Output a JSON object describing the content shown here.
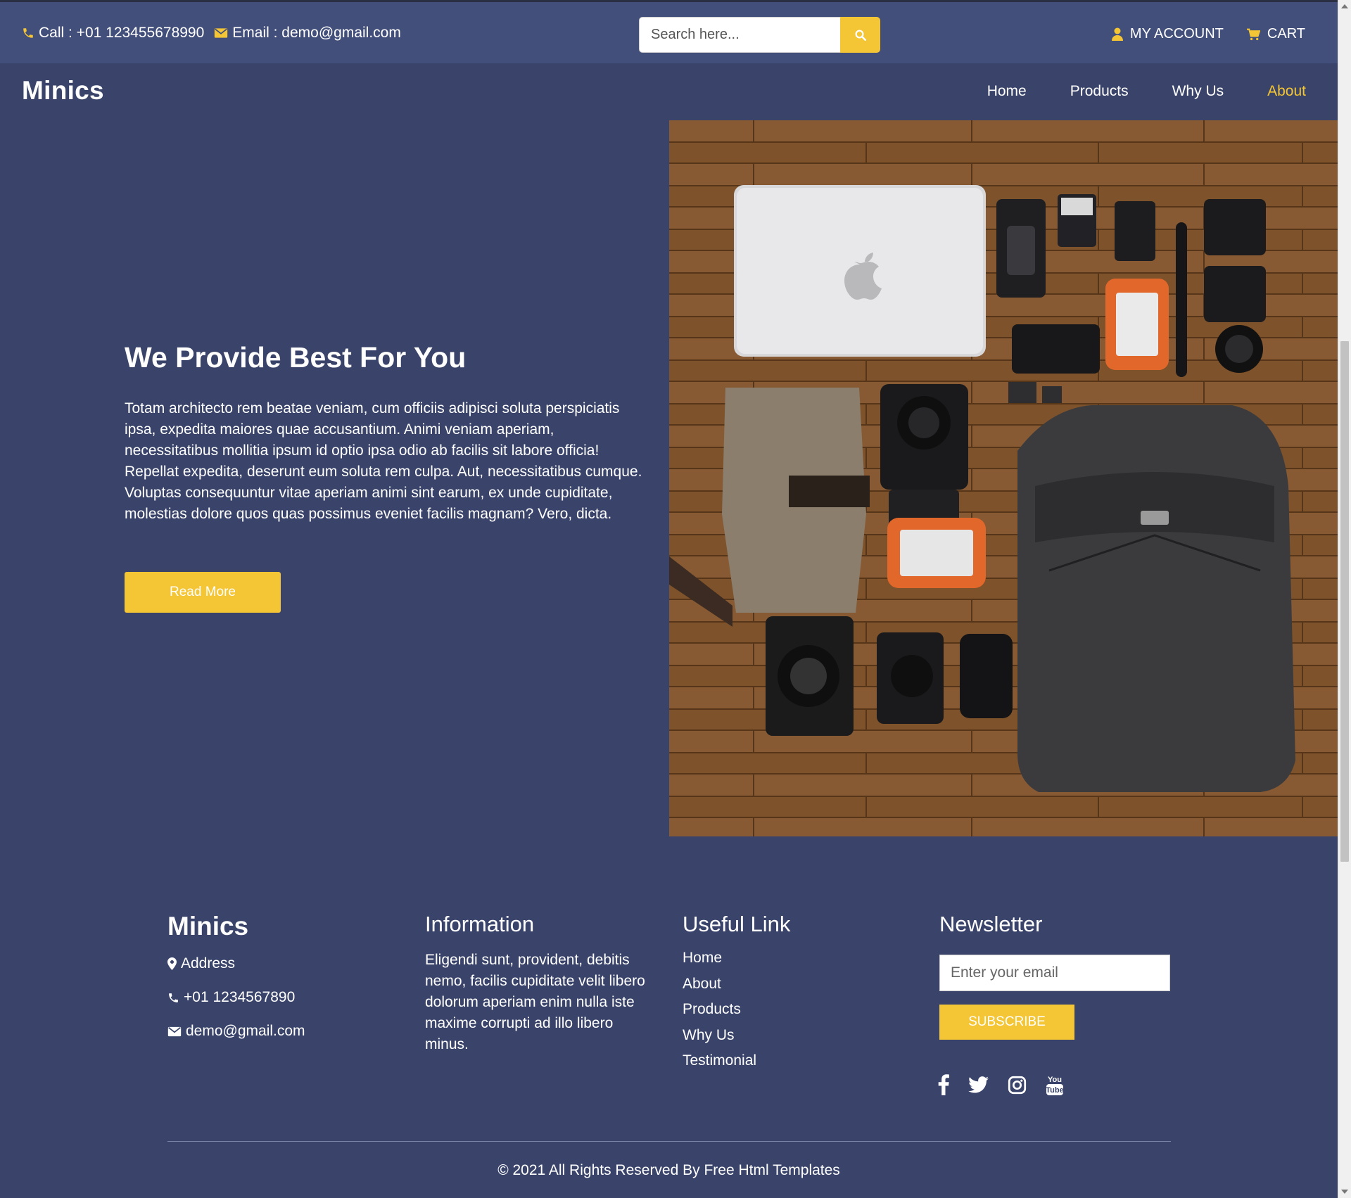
{
  "topbar": {
    "call_text": "Call : +01 123455678990",
    "email_text": "Email : demo@gmail.com",
    "search_placeholder": "Search here...",
    "my_account": "MY ACCOUNT",
    "cart": "CART"
  },
  "brand": {
    "name": "Minics"
  },
  "nav": {
    "items": [
      "Home",
      "Products",
      "Why Us",
      "About"
    ],
    "active": "About"
  },
  "hero": {
    "title": "We Provide Best For You",
    "body": "Totam architecto rem beatae veniam, cum officiis adipisci soluta perspiciatis ipsa, expedita maiores quae accusantium. Animi veniam aperiam, necessitatibus mollitia ipsum id optio ipsa odio ab facilis sit labore officia! Repellat expedita, deserunt eum soluta rem culpa. Aut, necessitatibus cumque. Voluptas consequuntur vitae aperiam animi sint earum, ex unde cupiditate, molestias dolore quos quas possimus eveniet facilis magnam? Vero, dicta.",
    "button": "Read More"
  },
  "footer": {
    "brand": "Minics",
    "address": "Address",
    "phone": "+01 1234567890",
    "email": "demo@gmail.com",
    "info_heading": "Information",
    "info_text": "Eligendi sunt, provident, debitis nemo, facilis cupiditate velit libero dolorum aperiam enim nulla iste maxime corrupti ad illo libero minus.",
    "links_heading": "Useful Link",
    "links": [
      "Home",
      "About",
      "Products",
      "Why Us",
      "Testimonial"
    ],
    "newsletter_heading": "Newsletter",
    "newsletter_placeholder": "Enter your email",
    "subscribe": "SUBSCRIBE",
    "socials": [
      "facebook-icon",
      "twitter-icon",
      "instagram-icon",
      "youtube-icon"
    ],
    "copyright": "© 2021 All Rights Reserved By Free Html Templates"
  },
  "colors": {
    "background": "#3a446a",
    "topbar": "#434f7b",
    "accent": "#f4c534",
    "text": "#ffffff"
  }
}
